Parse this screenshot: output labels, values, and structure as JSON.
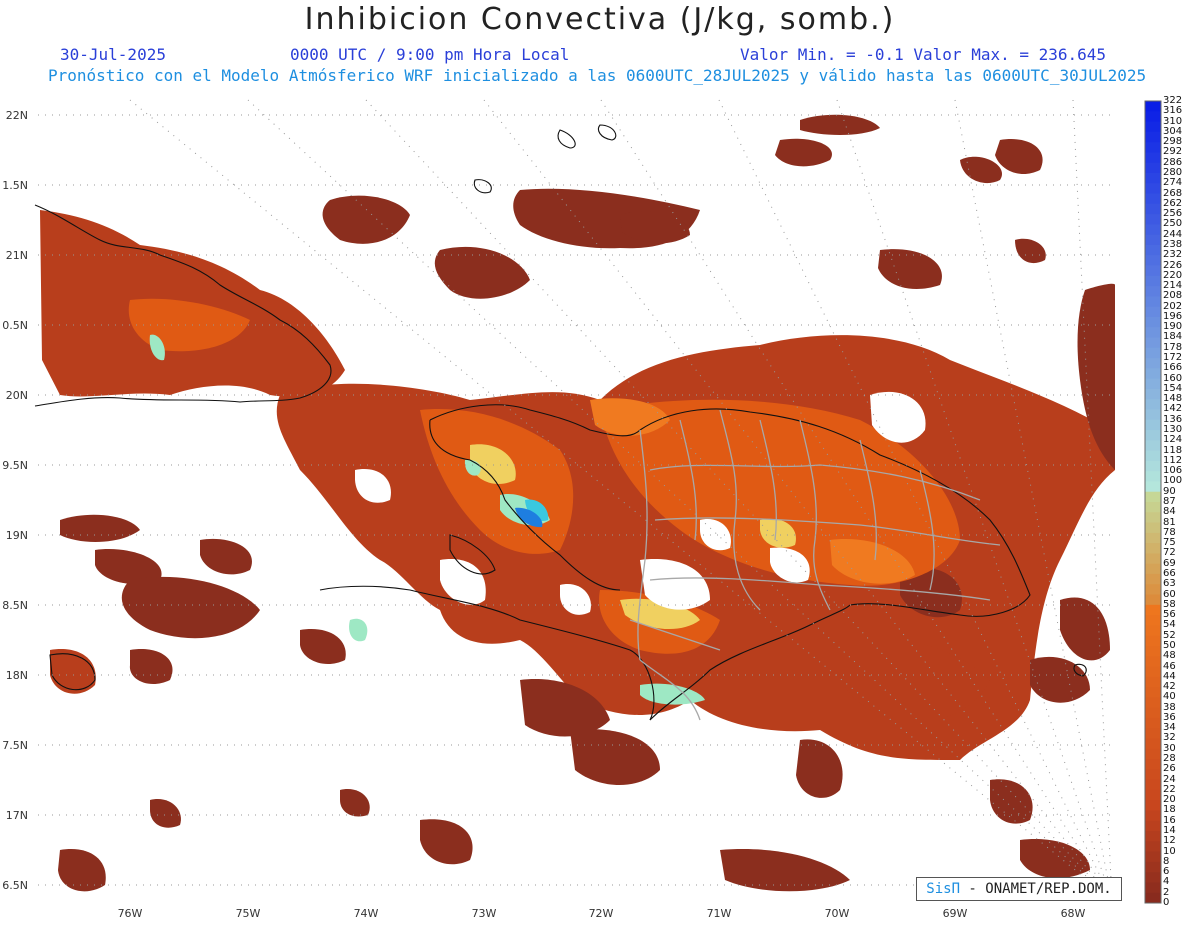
{
  "header": {
    "title": "Inhibicion Convectiva (J/kg, somb.)",
    "date": "30-Jul-2025",
    "time": "0000 UTC / 9:00 pm Hora Local",
    "value_range": "Valor Min. = -0.1  Valor Max. = 236.645",
    "model_info": "Pronóstico con el Modelo Atmósferico WRF inicializado a las 0600UTC_28JUL2025 y válido hasta las  0600UTC_30JUL2025"
  },
  "map": {
    "lat_labels": [
      "22N",
      "1.5N",
      "21N",
      "0.5N",
      "20N",
      "9.5N",
      "19N",
      "8.5N",
      "18N",
      "7.5N",
      "17N",
      "6.5N"
    ],
    "lon_labels": [
      "76W",
      "75W",
      "74W",
      "73W",
      "72W",
      "71W",
      "70W",
      "69W",
      "68W"
    ],
    "field_colors": {
      "dark": "#8b2e1e",
      "mid": "#b83e1c",
      "bright": "#e05a14",
      "peak": "#f07a20",
      "yellow": "#f0d060",
      "pale": "#9ee8c4",
      "cyan": "#3ac8e0",
      "blue": "#1e7ee0"
    }
  },
  "colorbar": {
    "labels": [
      "322",
      "316",
      "310",
      "304",
      "298",
      "292",
      "286",
      "280",
      "274",
      "268",
      "262",
      "256",
      "250",
      "244",
      "238",
      "232",
      "226",
      "220",
      "214",
      "208",
      "202",
      "196",
      "190",
      "184",
      "178",
      "172",
      "166",
      "160",
      "154",
      "148",
      "142",
      "136",
      "130",
      "124",
      "118",
      "112",
      "106",
      "100",
      "90",
      "87",
      "84",
      "81",
      "78",
      "75",
      "72",
      "69",
      "66",
      "63",
      "60",
      "58",
      "56",
      "54",
      "52",
      "50",
      "48",
      "46",
      "44",
      "42",
      "40",
      "38",
      "36",
      "34",
      "32",
      "30",
      "28",
      "26",
      "24",
      "22",
      "20",
      "18",
      "16",
      "14",
      "12",
      "10",
      "8",
      "6",
      "4",
      "2",
      "0"
    ]
  },
  "credit": {
    "sis": "SisΠ",
    "text": " - ONAMET/REP.DOM."
  }
}
